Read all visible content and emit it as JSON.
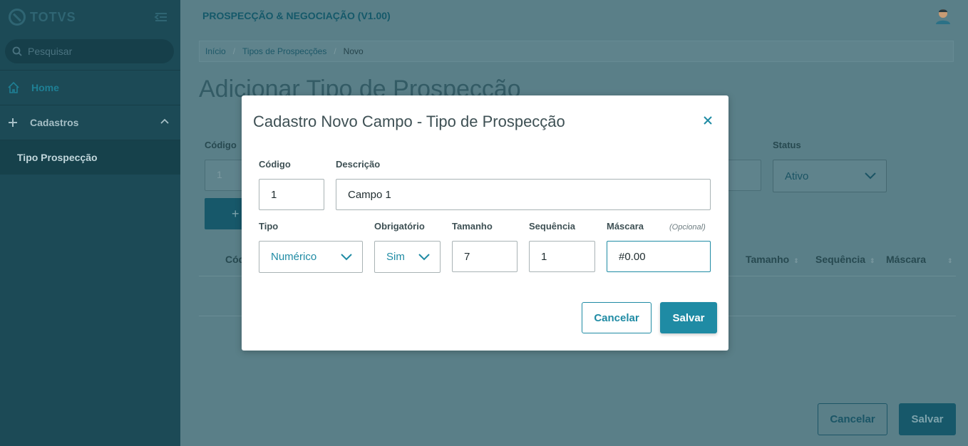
{
  "sidebar": {
    "brand": "TOTVS",
    "search_placeholder": "Pesquisar",
    "items": [
      {
        "label": "Home",
        "icon": "home-icon"
      },
      {
        "label": "Cadastros",
        "icon": "plus-icon"
      },
      {
        "label": "Tipo Prospecção"
      }
    ]
  },
  "header": {
    "app_title": "PROSPECÇÃO & NEGOCIAÇÃO (V1.00)"
  },
  "breadcrumb": [
    "Início",
    "Tipos de Prospecções",
    "Novo"
  ],
  "page": {
    "title": "Adicionar Tipo de Prospecção",
    "codigo_label": "Código",
    "codigo_value": "1",
    "status_label": "Status",
    "status_value": "Ativo",
    "add_button": "+",
    "table_headers": [
      "Códi",
      "Tamanho",
      "Sequência",
      "Máscara"
    ],
    "cancel_label": "Cancelar",
    "save_label": "Salvar"
  },
  "modal": {
    "title": "Cadastro Novo Campo - Tipo de Prospecção",
    "fields": {
      "codigo": {
        "label": "Código",
        "value": "1"
      },
      "descricao": {
        "label": "Descrição",
        "value": "Campo 1"
      },
      "tipo": {
        "label": "Tipo",
        "value": "Numérico"
      },
      "obrigatorio": {
        "label": "Obrigatório",
        "value": "Sim"
      },
      "tamanho": {
        "label": "Tamanho",
        "value": "7"
      },
      "sequencia": {
        "label": "Sequência",
        "value": "1"
      },
      "mascara": {
        "label": "Máscara",
        "optional": "(Opcional)",
        "value": "#0.00"
      }
    },
    "cancel_label": "Cancelar",
    "save_label": "Salvar"
  },
  "colors": {
    "accent": "#1f8ba4",
    "sidebar_bg": "#1c4a56",
    "overlay_bg": "#5a7f88"
  }
}
